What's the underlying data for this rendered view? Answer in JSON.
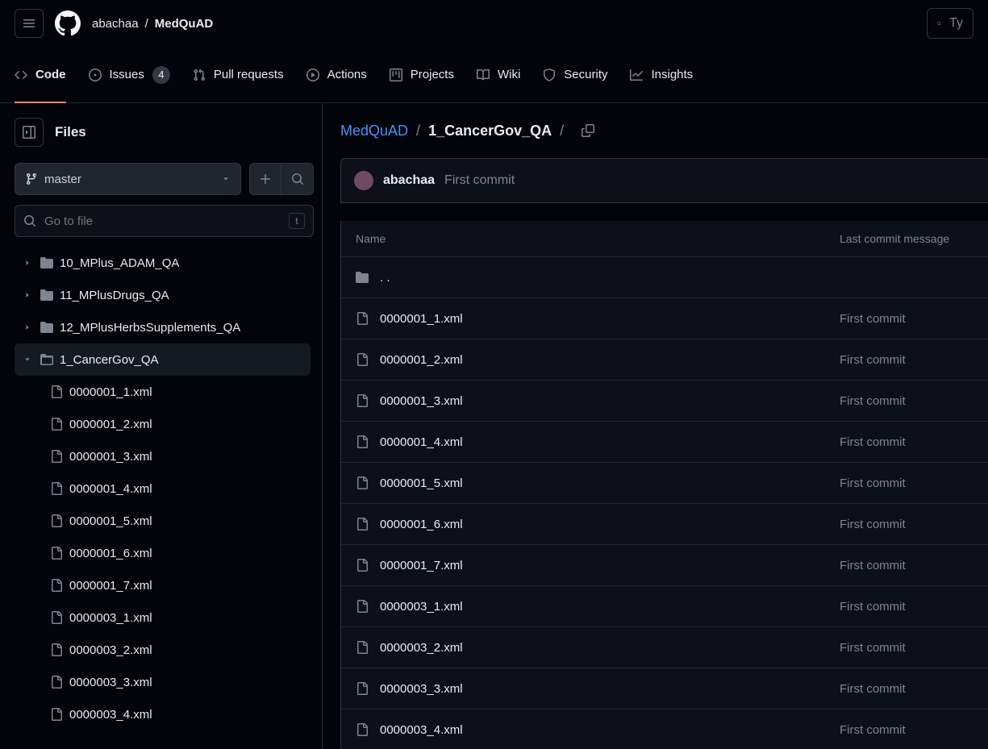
{
  "header": {
    "owner": "abachaa",
    "separator": "/",
    "repo": "MedQuAD",
    "search_placeholder": "Ty"
  },
  "nav": {
    "code": "Code",
    "issues": "Issues",
    "issues_count": "4",
    "pulls": "Pull requests",
    "actions": "Actions",
    "projects": "Projects",
    "wiki": "Wiki",
    "security": "Security",
    "insights": "Insights"
  },
  "sidebar": {
    "title": "Files",
    "branch": "master",
    "filter_placeholder": "Go to file",
    "filter_kbd": "t",
    "folders": [
      {
        "name": "10_MPlus_ADAM_QA",
        "open": false,
        "selected": false
      },
      {
        "name": "11_MPlusDrugs_QA",
        "open": false,
        "selected": false
      },
      {
        "name": "12_MPlusHerbsSupplements_QA",
        "open": false,
        "selected": false
      },
      {
        "name": "1_CancerGov_QA",
        "open": true,
        "selected": true
      }
    ],
    "files": [
      "0000001_1.xml",
      "0000001_2.xml",
      "0000001_3.xml",
      "0000001_4.xml",
      "0000001_5.xml",
      "0000001_6.xml",
      "0000001_7.xml",
      "0000003_1.xml",
      "0000003_2.xml",
      "0000003_3.xml",
      "0000003_4.xml"
    ]
  },
  "breadcrumb": {
    "root": "MedQuAD",
    "sep": "/",
    "current": "1_CancerGov_QA"
  },
  "commit": {
    "author": "abachaa",
    "message": "First commit"
  },
  "table": {
    "headers": {
      "name": "Name",
      "msg": "Last commit message"
    },
    "parent_label": ". .",
    "rows": [
      {
        "name": "0000001_1.xml",
        "msg": "First commit"
      },
      {
        "name": "0000001_2.xml",
        "msg": "First commit"
      },
      {
        "name": "0000001_3.xml",
        "msg": "First commit"
      },
      {
        "name": "0000001_4.xml",
        "msg": "First commit"
      },
      {
        "name": "0000001_5.xml",
        "msg": "First commit"
      },
      {
        "name": "0000001_6.xml",
        "msg": "First commit"
      },
      {
        "name": "0000001_7.xml",
        "msg": "First commit"
      },
      {
        "name": "0000003_1.xml",
        "msg": "First commit"
      },
      {
        "name": "0000003_2.xml",
        "msg": "First commit"
      },
      {
        "name": "0000003_3.xml",
        "msg": "First commit"
      },
      {
        "name": "0000003_4.xml",
        "msg": "First commit"
      }
    ]
  }
}
